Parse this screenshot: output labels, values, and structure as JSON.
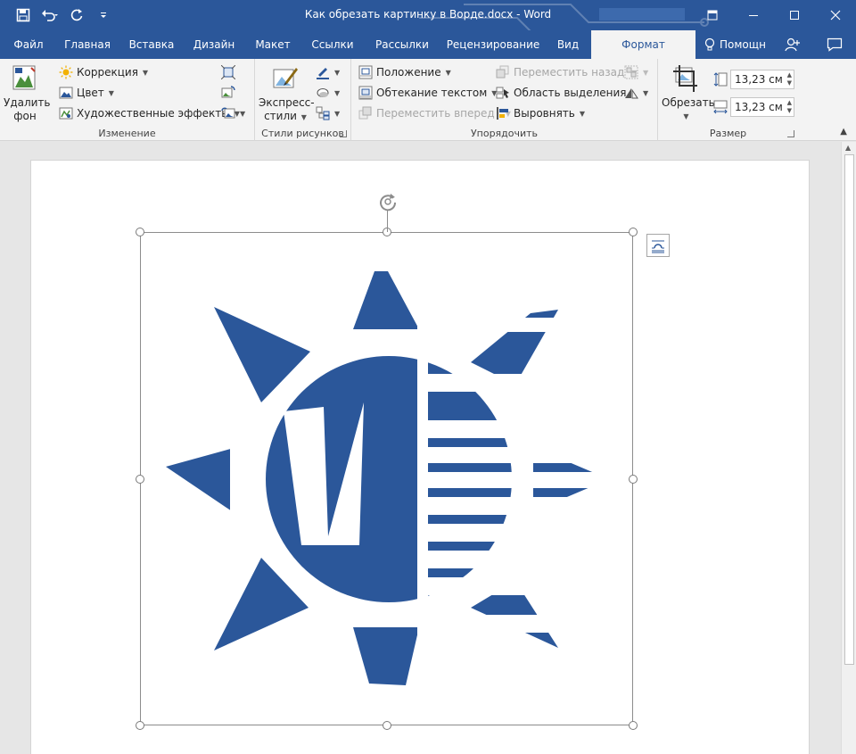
{
  "window": {
    "title": "Как обрезать картинку в Ворде.docx - Word",
    "controls": [
      "restore-ribbon-icon",
      "minimize-icon",
      "maximize-icon",
      "close-icon"
    ]
  },
  "qat": {
    "save_icon": "save-icon",
    "undo_icon": "undo-icon",
    "redo_icon": "repeat-icon",
    "customize_icon": "customize-qat-icon"
  },
  "tabs": [
    {
      "label": "Файл"
    },
    {
      "label": "Главная"
    },
    {
      "label": "Вставка"
    },
    {
      "label": "Дизайн"
    },
    {
      "label": "Макет"
    },
    {
      "label": "Ссылки"
    },
    {
      "label": "Рассылки"
    },
    {
      "label": "Рецензирование"
    },
    {
      "label": "Вид"
    },
    {
      "label": "Формат",
      "active": true
    }
  ],
  "tell_me": {
    "label": "Помощн"
  },
  "ribbon": {
    "change": {
      "label": "Изменение",
      "remove_bg_line1": "Удалить",
      "remove_bg_line2": "фон",
      "corrections": "Коррекция",
      "color": "Цвет",
      "artistic": "Художественные эффекты"
    },
    "styles": {
      "label": "Стили рисунков",
      "quick_line1": "Экспресс-",
      "quick_line2": "стили"
    },
    "arrange": {
      "label": "Упорядочить",
      "position": "Положение",
      "wrap_text": "Обтекание текстом",
      "bring_forward": "Переместить вперед",
      "send_backward": "Переместить назад",
      "selection_pane": "Область выделения",
      "align": "Выровнять"
    },
    "size": {
      "label": "Размер",
      "crop": "Обрезать",
      "height": "13,23 см",
      "width": "13,23 см"
    }
  },
  "colors": {
    "brand": "#2b579a",
    "ribbon_bg": "#f3f3f3",
    "doc_bg": "#e6e6e6",
    "logo_blue": "#2b579a"
  }
}
